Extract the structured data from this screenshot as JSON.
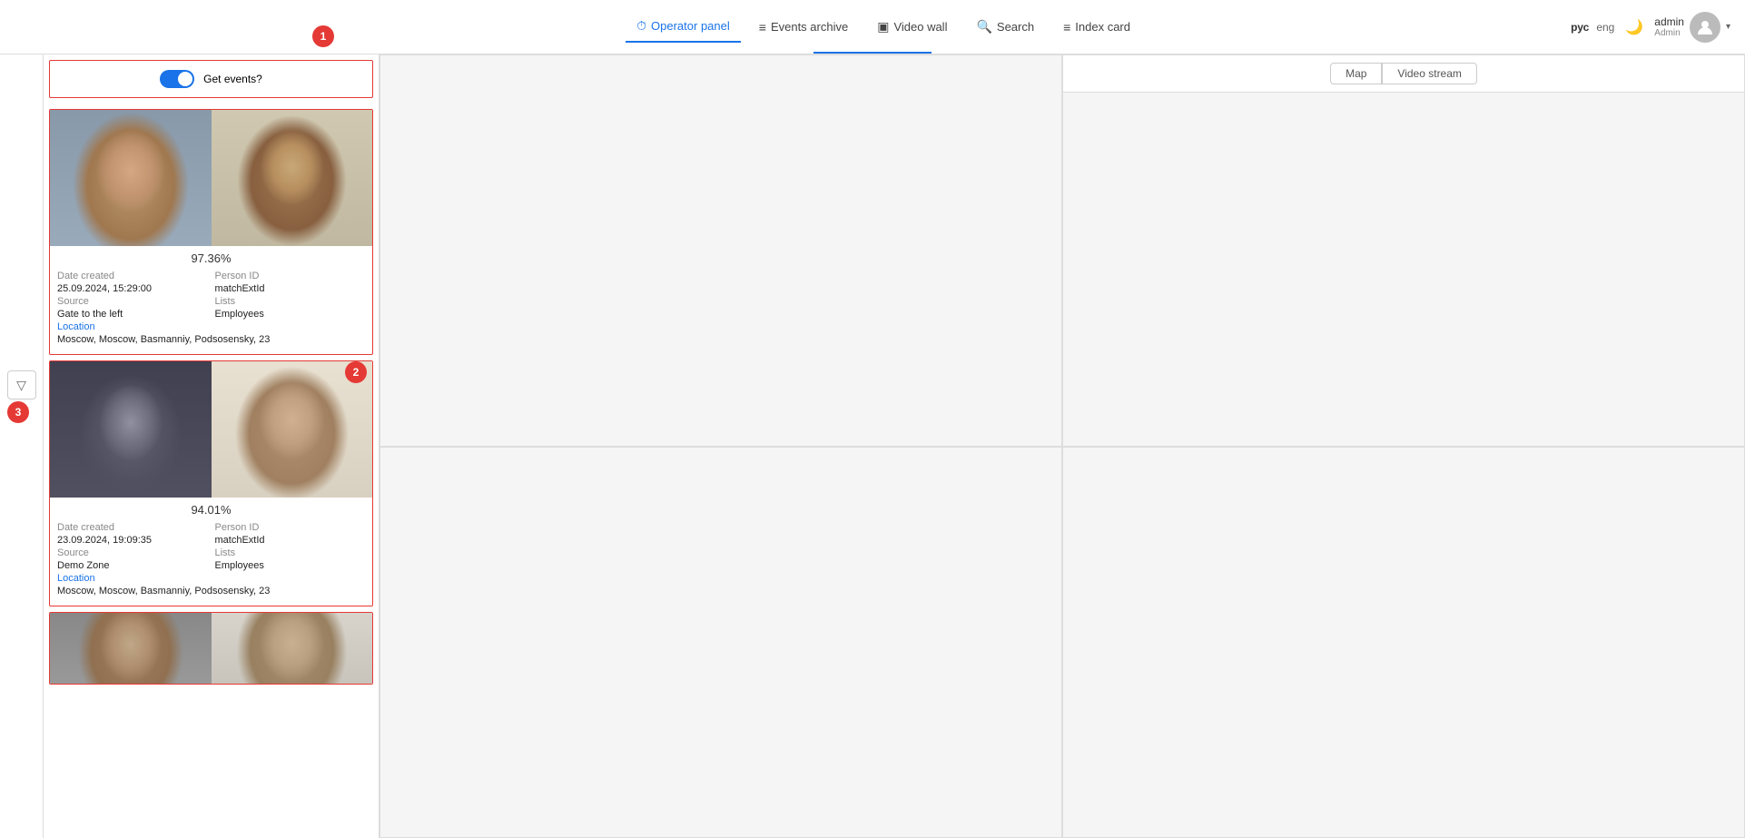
{
  "header": {
    "nav_items": [
      {
        "id": "operator-panel",
        "label": "Operator panel",
        "icon": "⏱",
        "active": true
      },
      {
        "id": "events-archive",
        "label": "Events archive",
        "icon": "≡",
        "active": false
      },
      {
        "id": "video-wall",
        "label": "Video wall",
        "icon": "▣",
        "active": false
      },
      {
        "id": "search",
        "label": "Search",
        "icon": "🔍",
        "active": false
      },
      {
        "id": "index-card",
        "label": "Index card",
        "icon": "≡",
        "active": false
      }
    ],
    "lang": {
      "ru": "рус",
      "en": "eng"
    },
    "user": {
      "name": "admin",
      "role": "Admin"
    }
  },
  "events_panel": {
    "get_events_label": "Get events?",
    "toggle_on": true,
    "events": [
      {
        "id": "event-1",
        "match_percent": "97.36%",
        "date_created_label": "Date created",
        "date_created_value": "25.09.2024, 15:29:00",
        "person_id_label": "Person ID",
        "person_id_value": "matchExtId",
        "source_label": "Source",
        "source_value": "Gate to the left",
        "lists_label": "Lists",
        "lists_value": "Employees",
        "location_label": "Location",
        "location_value": "Moscow, Moscow, Basmanniy, Podsosensky, 23"
      },
      {
        "id": "event-2",
        "match_percent": "94.01%",
        "date_created_label": "Date created",
        "date_created_value": "23.09.2024, 19:09:35",
        "person_id_label": "Person ID",
        "person_id_value": "matchExtId",
        "source_label": "Source",
        "source_value": "Demo Zone",
        "lists_label": "Lists",
        "lists_value": "Employees",
        "location_label": "Location",
        "location_value": "Moscow, Moscow, Basmanniy, Podsosensky, 23"
      }
    ]
  },
  "right_panel": {
    "top_right_tabs": [
      {
        "id": "map",
        "label": "Map",
        "active": false
      },
      {
        "id": "video-stream",
        "label": "Video stream",
        "active": false
      }
    ]
  },
  "badges": {
    "badge1": "1",
    "badge2": "2",
    "badge3": "3"
  },
  "filter_icon": "▽"
}
